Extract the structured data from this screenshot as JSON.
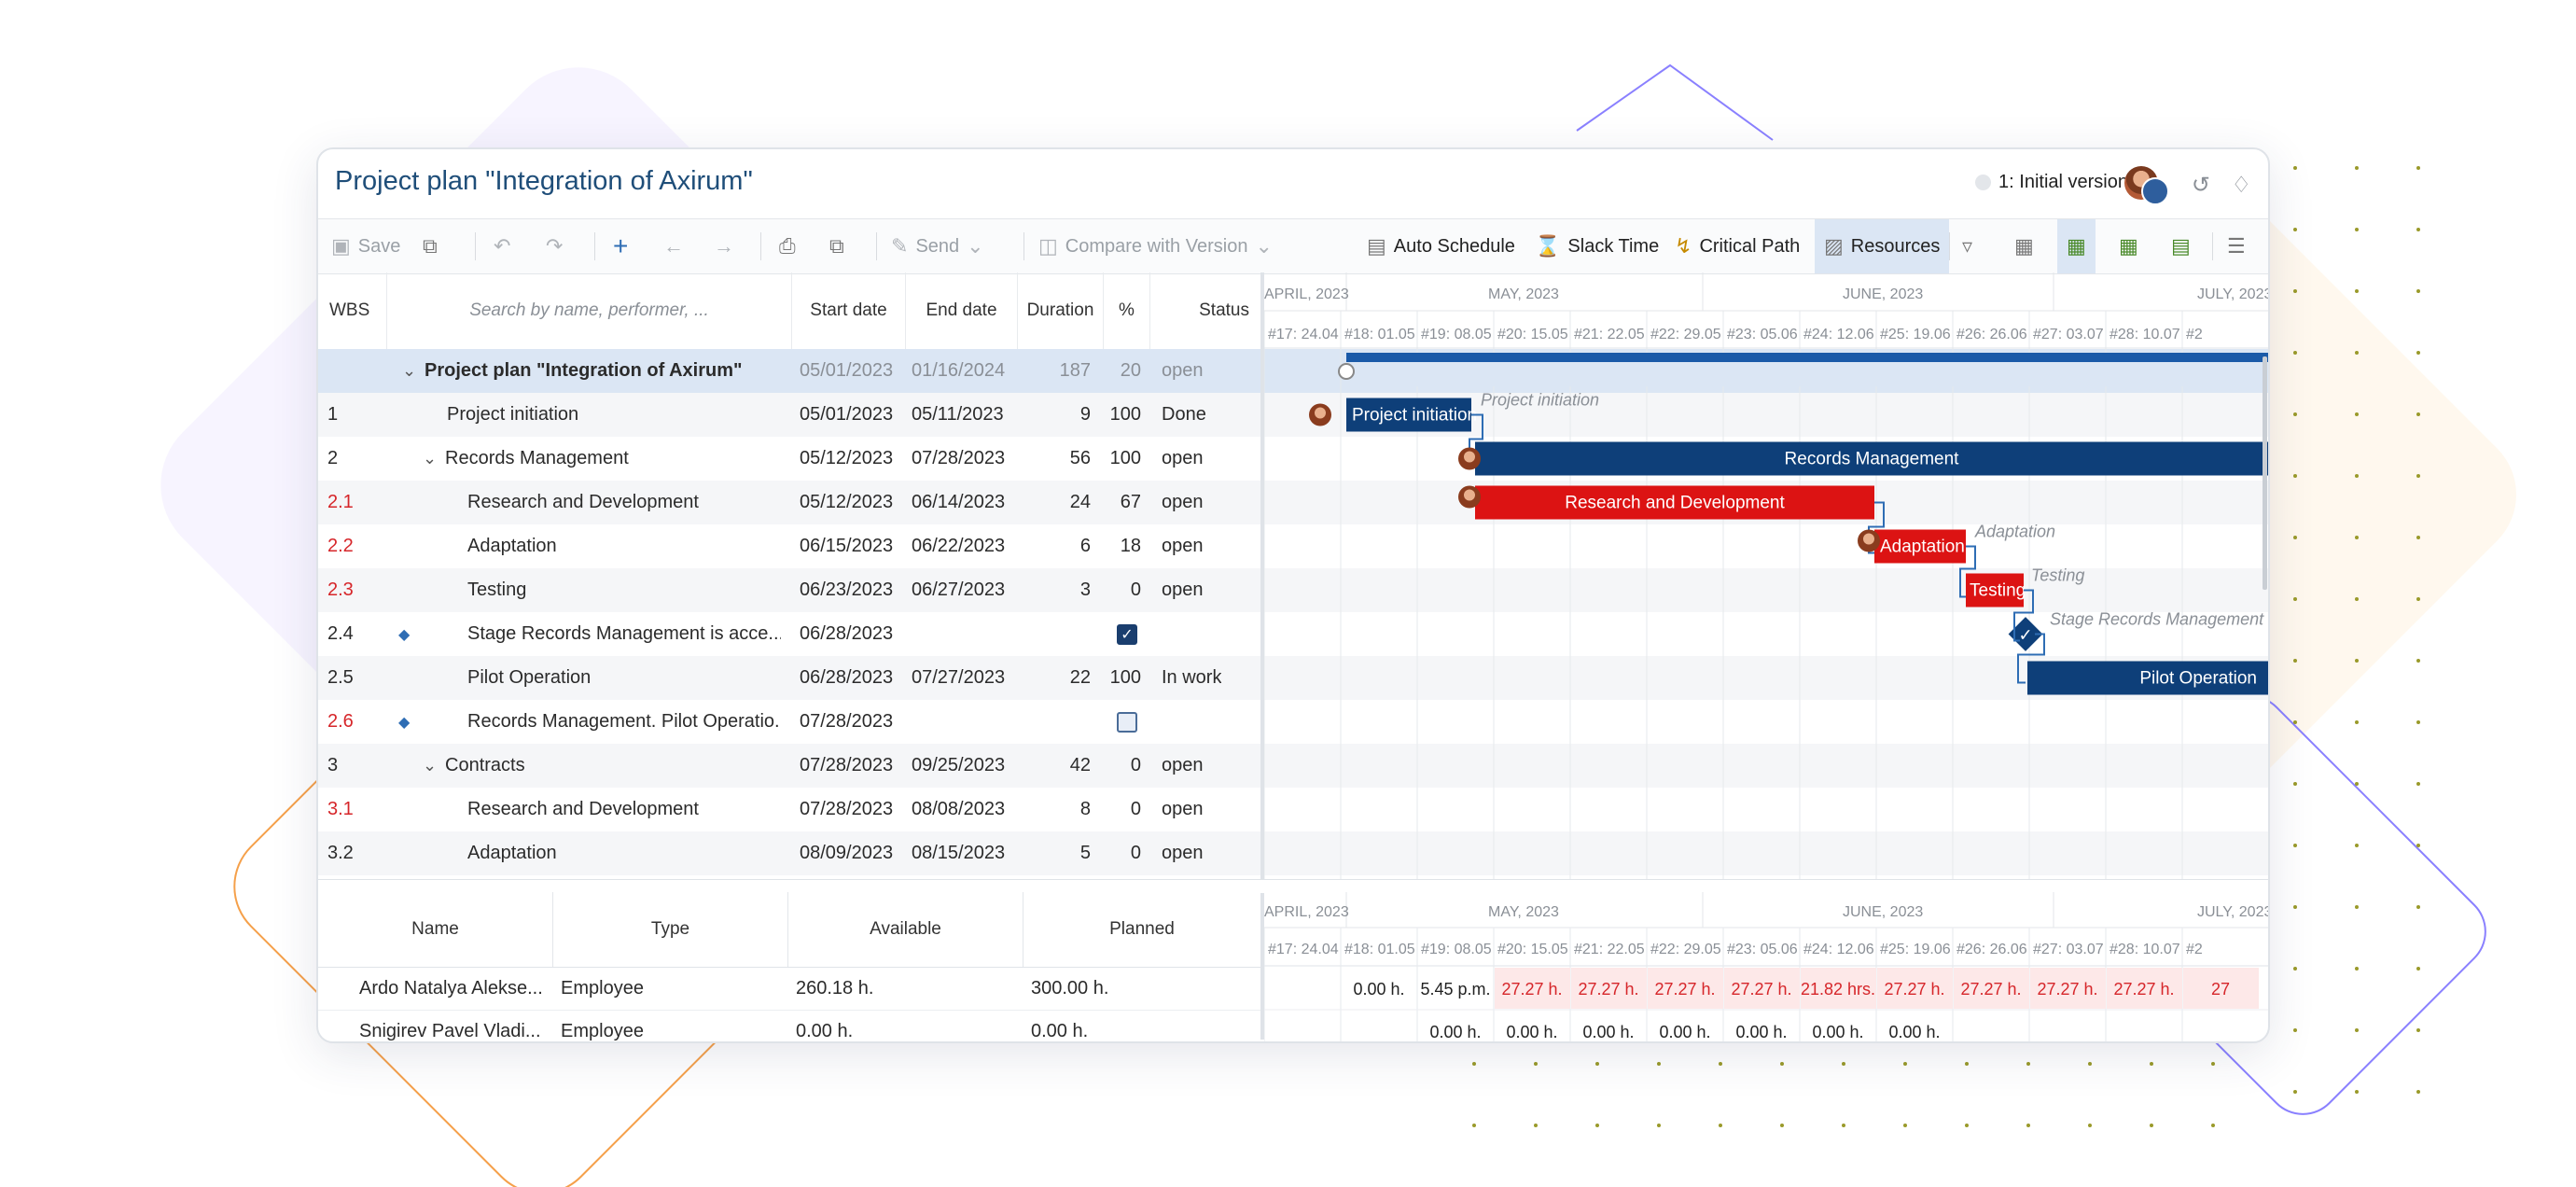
{
  "app": {
    "title": "Project plan \"Integration of Axirum\"",
    "version_label": "1: Initial version"
  },
  "toolbar": {
    "save": "Save",
    "send": "Send",
    "compare": "Compare with Version",
    "auto_schedule": "Auto Schedule",
    "slack_time": "Slack Time",
    "critical_path": "Critical Path",
    "resources": "Resources"
  },
  "grid": {
    "columns": {
      "wbs": "WBS",
      "search_placeholder": "Search by name, performer, ...",
      "start": "Start date",
      "end": "End date",
      "duration": "Duration",
      "percent": "%",
      "status": "Status"
    },
    "rows": [
      {
        "wbs": "",
        "name": "Project plan \"Integration of Axirum\"",
        "start": "05/01/2023",
        "end": "01/16/2024",
        "duration": "187",
        "percent": "20",
        "status": "open"
      },
      {
        "wbs": "1",
        "name": "Project initiation",
        "start": "05/01/2023",
        "end": "05/11/2023",
        "duration": "9",
        "percent": "100",
        "status": "Done"
      },
      {
        "wbs": "2",
        "name": "Records Management",
        "start": "05/12/2023",
        "end": "07/28/2023",
        "duration": "56",
        "percent": "100",
        "status": "open"
      },
      {
        "wbs": "2.1",
        "name": "Research and Development",
        "start": "05/12/2023",
        "end": "06/14/2023",
        "duration": "24",
        "percent": "67",
        "status": "open"
      },
      {
        "wbs": "2.2",
        "name": "Adaptation",
        "start": "06/15/2023",
        "end": "06/22/2023",
        "duration": "6",
        "percent": "18",
        "status": "open"
      },
      {
        "wbs": "2.3",
        "name": "Testing",
        "start": "06/23/2023",
        "end": "06/27/2023",
        "duration": "3",
        "percent": "0",
        "status": "open"
      },
      {
        "wbs": "2.4",
        "name": "Stage Records Management is acce...",
        "start": "06/28/2023",
        "end": "",
        "duration": "",
        "percent": "",
        "status": ""
      },
      {
        "wbs": "2.5",
        "name": "Pilot Operation",
        "start": "06/28/2023",
        "end": "07/27/2023",
        "duration": "22",
        "percent": "100",
        "status": "In work"
      },
      {
        "wbs": "2.6",
        "name": "Records Management. Pilot Operatio...",
        "start": "07/28/2023",
        "end": "",
        "duration": "",
        "percent": "",
        "status": ""
      },
      {
        "wbs": "3",
        "name": "Contracts",
        "start": "07/28/2023",
        "end": "09/25/2023",
        "duration": "42",
        "percent": "0",
        "status": "open"
      },
      {
        "wbs": "3.1",
        "name": "Research and Development",
        "start": "07/28/2023",
        "end": "08/08/2023",
        "duration": "8",
        "percent": "0",
        "status": "open"
      },
      {
        "wbs": "3.2",
        "name": "Adaptation",
        "start": "08/09/2023",
        "end": "08/15/2023",
        "duration": "5",
        "percent": "0",
        "status": "open"
      }
    ]
  },
  "timeline": {
    "months": [
      "APRIL, 2023",
      "MAY, 2023",
      "JUNE, 2023",
      "JULY, 2023"
    ],
    "weeks": [
      "#17: 24.04",
      "#18: 01.05",
      "#19: 08.05",
      "#20: 15.05",
      "#21: 22.05",
      "#22: 29.05",
      "#23: 05.06",
      "#24: 12.06",
      "#25: 19.06",
      "#26: 26.06",
      "#27: 03.07",
      "#28: 10.07",
      "#2"
    ]
  },
  "bars": {
    "project_initiation": "Project initiation",
    "project_initiation_side": "Project initiation",
    "records_management": "Records Management",
    "research": "Research and Development",
    "adaptation": "Adaptation",
    "adaptation_side": "Adaptation",
    "testing": "Testing",
    "testing_side": "Testing",
    "stage_side": "Stage Records Management",
    "pilot": "Pilot Operation"
  },
  "resources": {
    "columns": {
      "name": "Name",
      "type": "Type",
      "available": "Available",
      "planned": "Planned"
    },
    "rows": [
      {
        "name": "Ardo Natalya Alekse...",
        "type": "Employee",
        "available": "260.18 h.",
        "planned": "300.00 h.",
        "load": [
          "",
          "0.00 h.",
          "5.45 p.m.",
          "27.27 h.",
          "27.27 h.",
          "27.27 h.",
          "27.27 h.",
          "21.82 hrs.",
          "27.27 h.",
          "27.27 h.",
          "27.27 h.",
          "27.27 h.",
          "27"
        ]
      },
      {
        "name": "Snigirev Pavel Vladi...",
        "type": "Employee",
        "available": "0.00 h.",
        "planned": "0.00 h.",
        "load": [
          "",
          "",
          "0.00 h.",
          "0.00 h.",
          "0.00 h.",
          "0.00 h.",
          "0.00 h.",
          "0.00 h.",
          "0.00 h.",
          "",
          "",
          "",
          ""
        ]
      }
    ]
  },
  "colors": {
    "summary_bar": "#0e3f79",
    "critical_bar": "#dc1313",
    "header_blue": "#1f4e79",
    "overload_bg": "#fde8e8",
    "overload_text": "#d6262a"
  }
}
